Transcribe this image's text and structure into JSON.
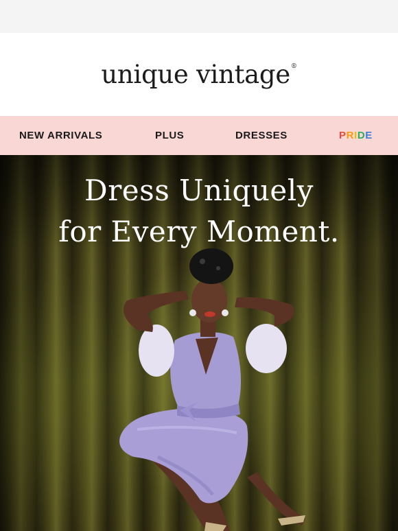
{
  "brand": {
    "logo_text": "unique vintage",
    "registered": "®"
  },
  "nav": {
    "items": [
      {
        "label": "NEW ARRIVALS"
      },
      {
        "label": "PLUS"
      },
      {
        "label": "DRESSES"
      }
    ],
    "pride": {
      "letters": [
        "P",
        "R",
        "I",
        "D",
        "E"
      ],
      "colors": [
        "#e84b3c",
        "#f39c12",
        "#e6c200",
        "#27ae60",
        "#3b7dd8"
      ]
    }
  },
  "hero": {
    "headline_line1": "Dress Uniquely",
    "headline_line2": "for Every Moment."
  },
  "colors": {
    "nav_background": "#f9d7d4",
    "curtain": "#4a4a1c",
    "dress": "#a99fd6"
  }
}
